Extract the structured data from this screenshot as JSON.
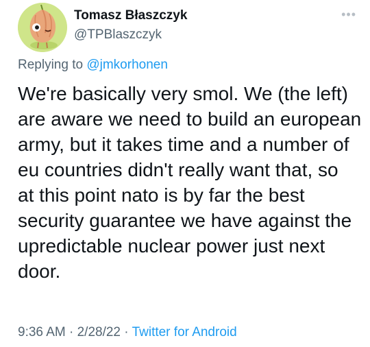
{
  "author": {
    "name": "Tomasz Błaszczyk",
    "handle": "@TPBlaszczyk"
  },
  "reply": {
    "prefix": "Replying to ",
    "mention": "@jmkorhonen"
  },
  "tweet": {
    "lines": [
      "We're basically very smol. We (the left)",
      "are aware we need to build an european",
      "army, but it takes time and a number of",
      "eu countries didn't really want that, so",
      "at this point nato is by far the best",
      "security guarantee we have against the",
      "upredictable nuclear power just next",
      "door."
    ]
  },
  "footer": {
    "time": "9:36 AM",
    "sep1": " · ",
    "date": "2/28/22",
    "sep2": " · ",
    "source": "Twitter for Android"
  },
  "icons": {
    "more": "more-options-icon",
    "avatar": "fruit-character-avatar"
  },
  "colors": {
    "accent": "#1d9bf0",
    "muted": "#536471",
    "text": "#0f1419",
    "avatar_bg": "#cfe58a",
    "avatar_fruit": "#e9a67a"
  }
}
